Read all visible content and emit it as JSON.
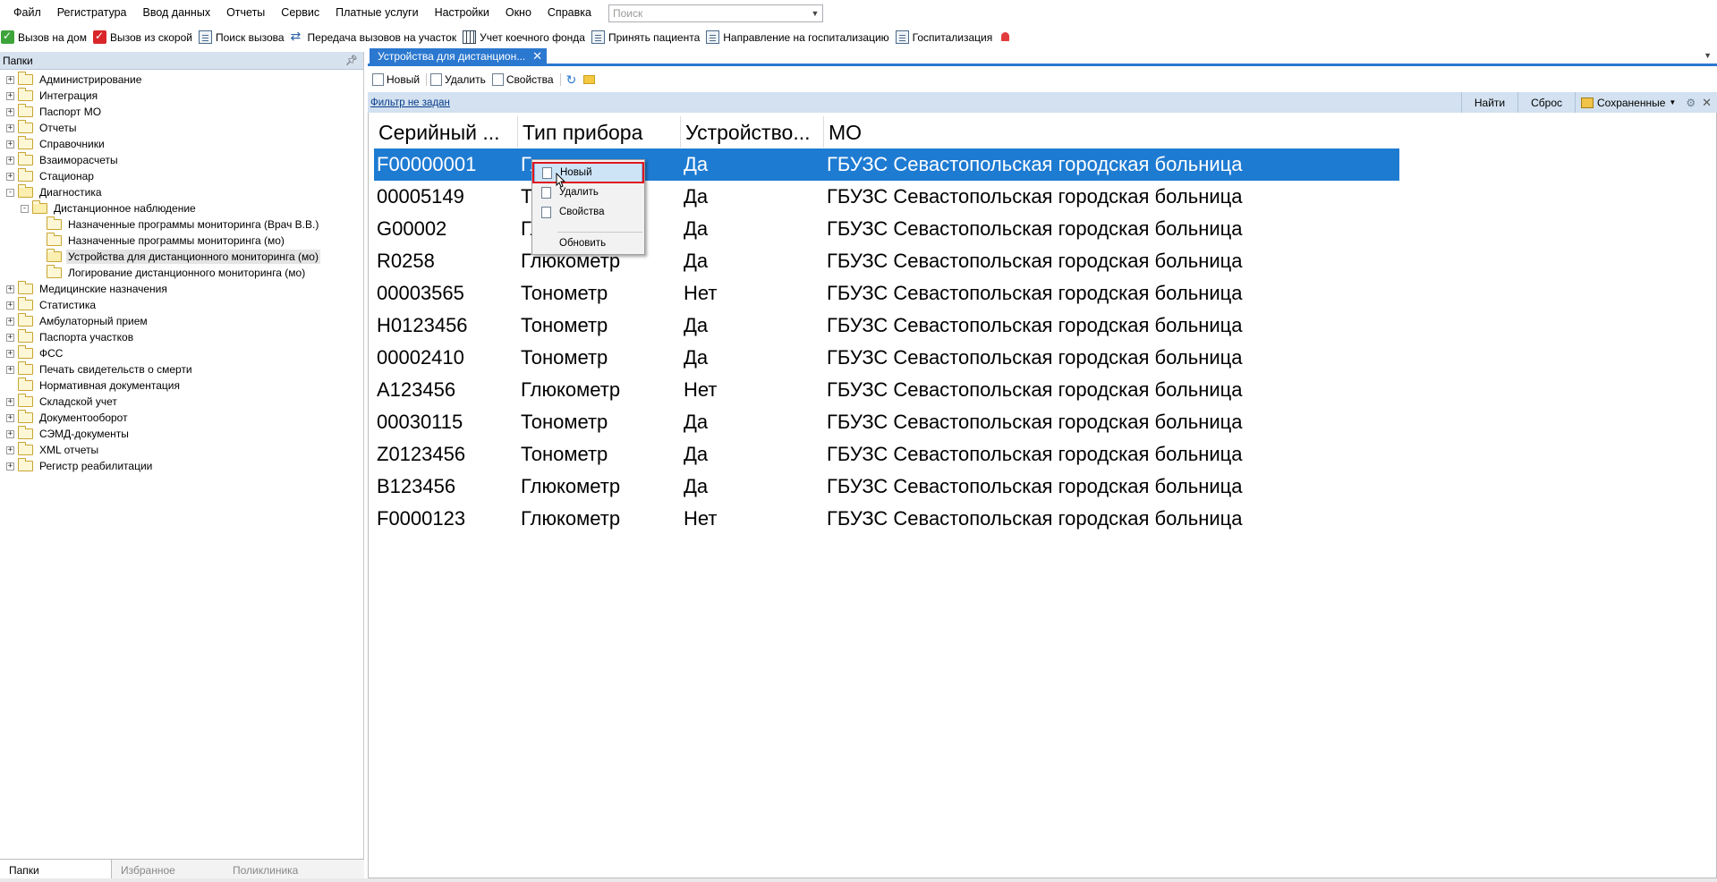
{
  "menubar": {
    "items": [
      "Файл",
      "Регистратура",
      "Ввод данных",
      "Отчеты",
      "Сервис",
      "Платные услуги",
      "Настройки",
      "Окно",
      "Справка"
    ],
    "search_placeholder": "Поиск"
  },
  "quickbar": {
    "items": [
      {
        "label": "Вызов на дом",
        "icon": "house-call-icon"
      },
      {
        "label": "Вызов из скорой",
        "icon": "ambulance-call-icon"
      },
      {
        "label": "Поиск вызова",
        "icon": "search-call-icon"
      },
      {
        "label": "Передача вызовов на участок",
        "icon": "transfer-icon"
      },
      {
        "label": "Учет коечного фонда",
        "icon": "bed-grid-icon"
      },
      {
        "label": "Принять пациента",
        "icon": "accept-patient-icon"
      },
      {
        "label": "Направление на госпитализацию",
        "icon": "referral-icon"
      },
      {
        "label": "Госпитализация",
        "icon": "hospitalization-icon"
      }
    ]
  },
  "left_panel": {
    "title": "Папки",
    "tree": [
      {
        "label": "Администрирование",
        "level": 0,
        "exp": "+"
      },
      {
        "label": "Интеграция",
        "level": 0,
        "exp": "+"
      },
      {
        "label": "Паспорт МО",
        "level": 0,
        "exp": "+"
      },
      {
        "label": "Отчеты",
        "level": 0,
        "exp": "+"
      },
      {
        "label": "Справочники",
        "level": 0,
        "exp": "+"
      },
      {
        "label": "Взаиморасчеты",
        "level": 0,
        "exp": "+"
      },
      {
        "label": "Стационар",
        "level": 0,
        "exp": "+"
      },
      {
        "label": "Диагностика",
        "level": 0,
        "exp": "-",
        "open": true
      },
      {
        "label": "Дистанционное наблюдение",
        "level": 1,
        "exp": "-",
        "open": true
      },
      {
        "label": "Назначенные программы мониторинга (Врач В.В.)",
        "level": 2,
        "exp": ""
      },
      {
        "label": "Назначенные программы мониторинга (мо)",
        "level": 2,
        "exp": ""
      },
      {
        "label": "Устройства для дистанционного мониторинга (мо)",
        "level": 2,
        "exp": "",
        "selected": true,
        "open": true
      },
      {
        "label": "Логирование дистанционного мониторинга (мо)",
        "level": 2,
        "exp": ""
      },
      {
        "label": "Медицинские назначения",
        "level": 0,
        "exp": "+"
      },
      {
        "label": "Статистика",
        "level": 0,
        "exp": "+"
      },
      {
        "label": "Амбулаторный прием",
        "level": 0,
        "exp": "+"
      },
      {
        "label": "Паспорта участков",
        "level": 0,
        "exp": "+"
      },
      {
        "label": "ФСС",
        "level": 0,
        "exp": "+"
      },
      {
        "label": "Печать свидетельств о смерти",
        "level": 0,
        "exp": "+"
      },
      {
        "label": "Нормативная документация",
        "level": 0,
        "exp": ""
      },
      {
        "label": "Складской учет",
        "level": 0,
        "exp": "+"
      },
      {
        "label": "Документооборот",
        "level": 0,
        "exp": "+"
      },
      {
        "label": "СЭМД-документы",
        "level": 0,
        "exp": "+"
      },
      {
        "label": "XML отчеты",
        "level": 0,
        "exp": "+"
      },
      {
        "label": "Регистр реабилитации",
        "level": 0,
        "exp": "+"
      }
    ],
    "tabs": [
      "Папки",
      "Избранное",
      "Поликлиника"
    ]
  },
  "doc_tab": {
    "label": "Устройства для дистанцион..."
  },
  "toolbar": {
    "new_label": "Новый",
    "delete_label": "Удалить",
    "properties_label": "Свойства"
  },
  "filter_bar": {
    "filter_text": "Фильтр не задан",
    "find_label": "Найти",
    "reset_label": "Сброс",
    "saved_label": "Сохраненные"
  },
  "grid": {
    "columns": [
      "Серийный ...",
      "Тип прибора",
      "Устройство...",
      "МО"
    ],
    "rows": [
      [
        "F00000001",
        "Глюкометр",
        "Да",
        "ГБУЗС Севастопольская городская больница"
      ],
      [
        "00005149",
        "Тонометр",
        "Да",
        "ГБУЗС Севастопольская городская больница"
      ],
      [
        "G00002",
        "Глюкометр",
        "Да",
        "ГБУЗС Севастопольская городская больница"
      ],
      [
        "R0258",
        "Глюкометр",
        "Да",
        "ГБУЗС Севастопольская городская больница"
      ],
      [
        "00003565",
        "Тонометр",
        "Нет",
        "ГБУЗС Севастопольская городская больница"
      ],
      [
        "H0123456",
        "Тонометр",
        "Да",
        "ГБУЗС Севастопольская городская больница"
      ],
      [
        "00002410",
        "Тонометр",
        "Да",
        "ГБУЗС Севастопольская городская больница"
      ],
      [
        "A123456",
        "Глюкометр",
        "Нет",
        "ГБУЗС Севастопольская городская больница"
      ],
      [
        "00030115",
        "Тонометр",
        "Да",
        "ГБУЗС Севастопольская городская больница"
      ],
      [
        "Z0123456",
        "Тонометр",
        "Да",
        "ГБУЗС Севастопольская городская больница"
      ],
      [
        "B123456",
        "Глюкометр",
        "Да",
        "ГБУЗС Севастопольская городская больница"
      ],
      [
        "F0000123",
        "Глюкометр",
        "Нет",
        "ГБУЗС Севастопольская городская больница"
      ]
    ],
    "selected_row": 0
  },
  "context_menu": {
    "items": [
      {
        "label": "Новый",
        "icon": "new-doc-icon"
      },
      {
        "label": "Удалить",
        "icon": "delete-doc-icon"
      },
      {
        "label": "Свойства",
        "icon": "properties-icon"
      },
      {
        "label": "Обновить",
        "icon": ""
      }
    ]
  },
  "colors": {
    "accent": "#2b78d0",
    "selection": "#1e7bd2",
    "filter_bar": "#d3e1f0",
    "highlight_box": "#e0141f"
  }
}
